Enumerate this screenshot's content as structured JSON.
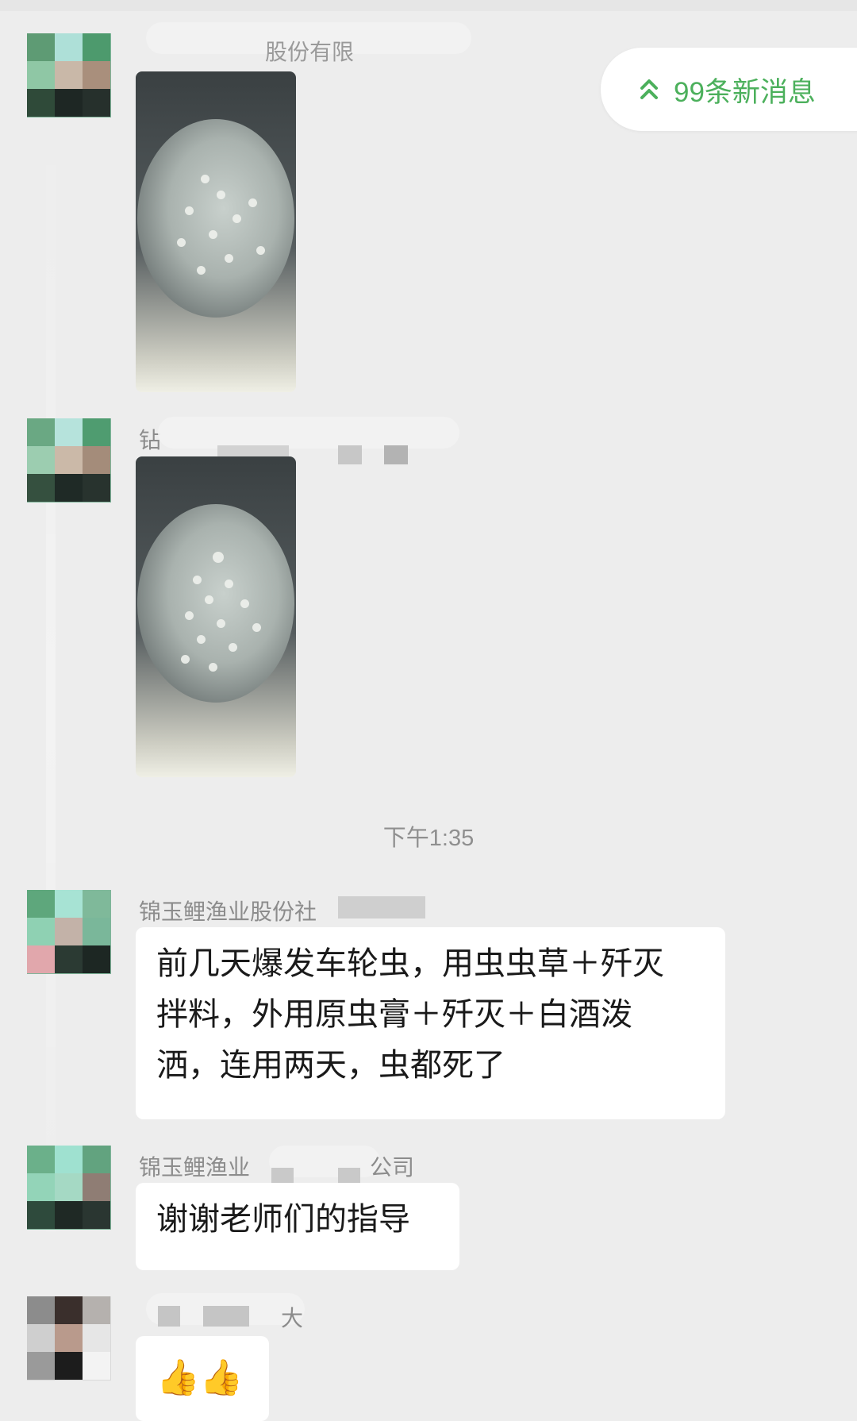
{
  "new_messages": {
    "label": "99条新消息",
    "icon": "double-chevron-up-icon",
    "color": "#4cb05c"
  },
  "chat": {
    "timestamp": "下午1:35",
    "messages": [
      {
        "sender": "股份有限",
        "type": "image"
      },
      {
        "sender": "钻",
        "type": "image"
      },
      {
        "sender": "锦玉鲤渔业股份社",
        "type": "text",
        "lines": [
          "前几天爆发车轮虫，用虫虫草＋歼灭",
          "拌料，外用原虫膏＋歼灭＋白酒泼",
          "洒，连用两天，虫都死了"
        ]
      },
      {
        "sender": "锦玉鲤渔业",
        "sender_suffix": "公司",
        "type": "text",
        "lines": [
          "谢谢老师们的指导"
        ]
      },
      {
        "sender": "大",
        "type": "emoji",
        "emoji": "👍👍"
      }
    ]
  }
}
